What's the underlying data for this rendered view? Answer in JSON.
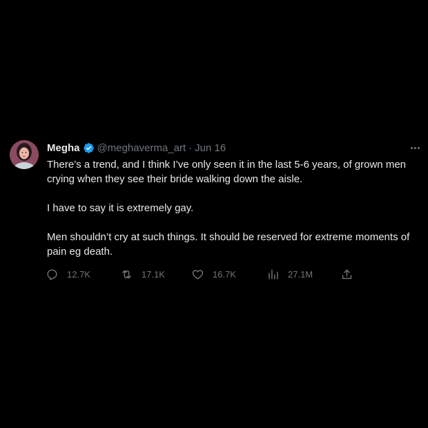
{
  "tweet": {
    "author_name": "Megha",
    "handle": "@meghaverma_art",
    "separator": "·",
    "date": "Jun 16",
    "paragraphs": [
      "There’s a trend, and I think I’ve only seen it in the last 5-6 years, of grown men crying when they see their bride walking down the aisle.",
      "I have to say it is extremely gay.",
      "Men shouldn’t cry at such things. It should be reserved for extreme moments of pain eg death."
    ],
    "stats": {
      "replies": "12.7K",
      "retweets": "17.1K",
      "likes": "16.7K",
      "views": "27.1M"
    }
  },
  "icons": {
    "verified": "verified-badge-icon",
    "more": "more-options-icon",
    "reply": "reply-icon",
    "retweet": "retweet-icon",
    "like": "heart-icon",
    "views": "views-chart-icon",
    "share": "share-icon"
  },
  "colors": {
    "background": "#000000",
    "text_primary": "#e7e9ea",
    "text_secondary": "#71767b",
    "verified_blue": "#1d9bf0"
  }
}
